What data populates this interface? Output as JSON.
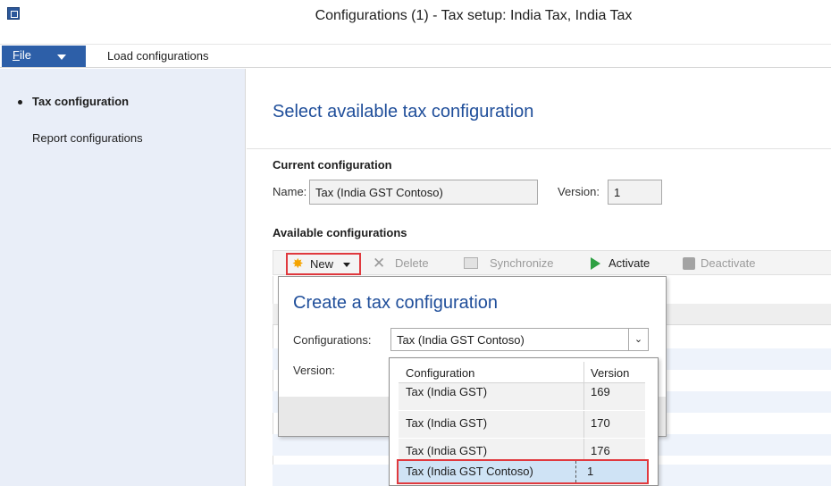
{
  "window": {
    "title": "Configurations (1) - Tax setup: India Tax, India Tax"
  },
  "menu": {
    "file_label_underlined": "F",
    "file_label_rest": "ile",
    "load_label": "Load configurations"
  },
  "nav": {
    "items": [
      "Tax configuration",
      "Report configurations"
    ]
  },
  "main": {
    "title": "Select available tax configuration",
    "current": {
      "heading": "Current configuration",
      "name_label": "Name:",
      "name_value": "Tax (India GST Contoso)",
      "version_label": "Version:",
      "version_value": "1"
    },
    "available": {
      "heading": "Available configurations",
      "toolbar": {
        "new": "New",
        "delete": "Delete",
        "synchronize": "Synchronize",
        "activate": "Activate",
        "deactivate": "Deactivate"
      }
    }
  },
  "popup": {
    "title": "Create a tax configuration",
    "config_label": "Configurations:",
    "config_value": "Tax (India GST Contoso)",
    "version_label": "Version:"
  },
  "dropdown": {
    "headers": [
      "Configuration",
      "Version"
    ],
    "rows": [
      {
        "config": "Tax (India GST)",
        "version": "169"
      },
      {
        "config": "Tax (India GST)",
        "version": "170"
      },
      {
        "config": "Tax (India GST)",
        "version": "176"
      },
      {
        "config": "Tax (India GST Contoso)",
        "version": "1"
      }
    ]
  },
  "colors": {
    "accent": "#2d5fa8",
    "highlight": "#e0393e",
    "title": "#1f4e9a"
  }
}
